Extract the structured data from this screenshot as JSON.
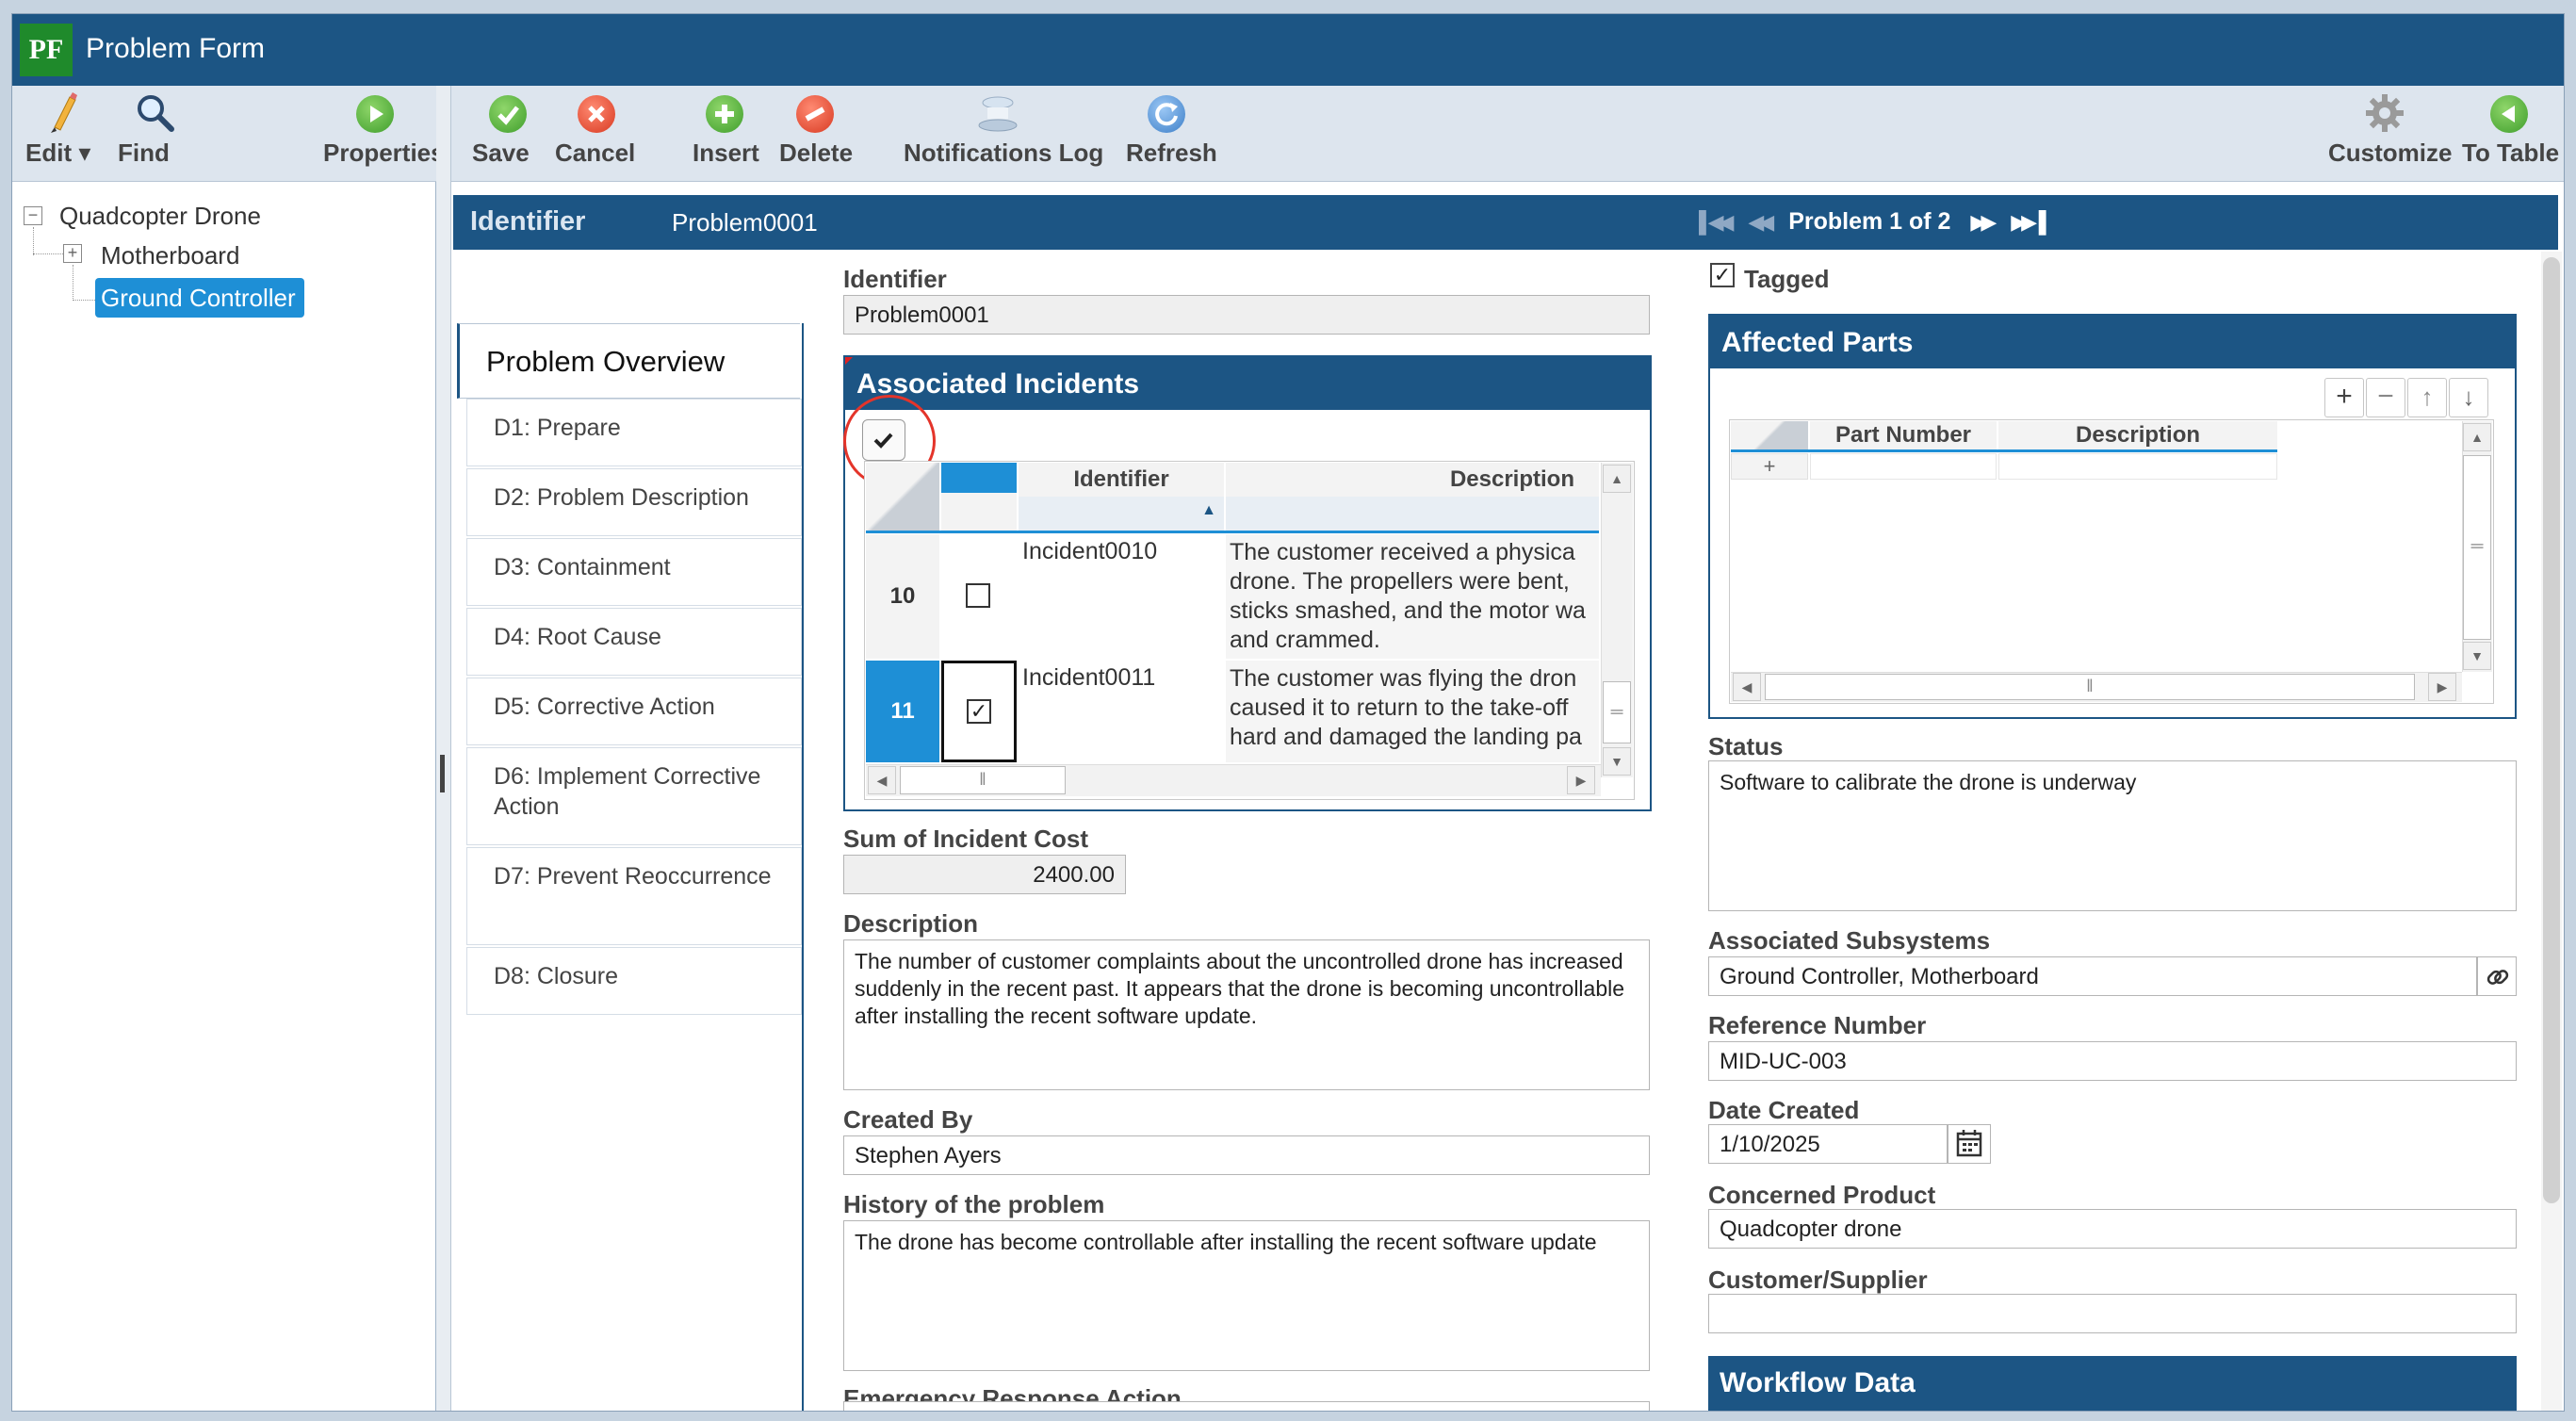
{
  "app": {
    "logo": "PF",
    "title": "Problem Form"
  },
  "left_toolbar": [
    {
      "label": "Edit ▾",
      "icon": "pencil-icon"
    },
    {
      "label": "Find",
      "icon": "magnifier-icon"
    },
    {
      "label": "Properties",
      "icon": "play-circle-icon"
    }
  ],
  "tree": {
    "root": "Quadcopter Drone",
    "children": [
      "Motherboard",
      "Ground Controller"
    ],
    "selected": "Ground Controller"
  },
  "main_toolbar": {
    "save": "Save",
    "cancel": "Cancel",
    "insert": "Insert",
    "delete": "Delete",
    "notifications": "Notifications Log",
    "refresh": "Refresh",
    "customize": "Customize",
    "to_table": "To Table"
  },
  "idbar": {
    "label": "Identifier",
    "value": "Problem0001",
    "pager": "Problem 1 of 2"
  },
  "nav": {
    "active": "Problem Overview",
    "items": [
      "D1: Prepare",
      "D2: Problem Description",
      "D3: Containment",
      "D4: Root Cause",
      "D5: Corrective Action",
      "D6: Implement Corrective Action",
      "D7: Prevent Reoccurrence",
      "D8: Closure"
    ]
  },
  "form": {
    "identifier_label": "Identifier",
    "identifier_value": "Problem0001",
    "incidents_title": "Associated Incidents",
    "incidents_columns": [
      "Identifier",
      "Description"
    ],
    "incidents_rows": [
      {
        "num": "10",
        "checked": false,
        "id": "Incident0010",
        "desc": "The customer received a physica drone. The propellers were bent, sticks smashed, and the motor wa and crammed."
      },
      {
        "num": "11",
        "checked": true,
        "id": "Incident0011",
        "desc": "The customer was flying the dron caused it to return to the take-off hard and damaged the landing pa"
      }
    ],
    "sum_label": "Sum of Incident Cost",
    "sum_value": "2400.00",
    "description_label": "Description",
    "description_value": "The number of customer complaints about the uncontrolled drone has increased suddenly in the recent past. It appears that the drone is becoming uncontrollable after installing the recent software update.",
    "created_by_label": "Created By",
    "created_by_value": "Stephen Ayers",
    "history_label": "History of the problem",
    "history_value": "The drone has become controllable after installing the recent software update",
    "emergency_label": "Emergency Response Action"
  },
  "right": {
    "tagged_label": "Tagged",
    "tagged": true,
    "parts_title": "Affected Parts",
    "parts_columns": [
      "Part Number",
      "Description"
    ],
    "status_label": "Status",
    "status_value": "Software to calibrate the drone is underway",
    "subsystems_label": "Associated Subsystems",
    "subsystems_value": "Ground Controller, Motherboard",
    "reference_label": "Reference Number",
    "reference_value": "MID-UC-003",
    "date_label": "Date Created",
    "date_value": "1/10/2025",
    "product_label": "Concerned Product",
    "product_value": "Quadcopter drone",
    "customer_label": "Customer/Supplier",
    "customer_value": "",
    "workflow_title": "Workflow Data"
  }
}
